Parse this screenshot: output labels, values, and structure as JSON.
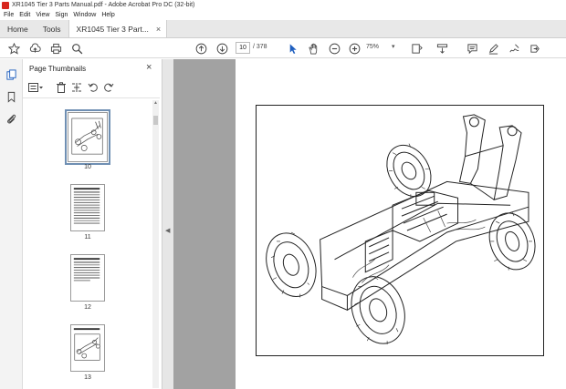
{
  "window": {
    "title": "XR1045 Tier 3 Parts Manual.pdf - Adobe Acrobat Pro DC (32-bit)"
  },
  "menu": [
    "File",
    "Edit",
    "View",
    "Sign",
    "Window",
    "Help"
  ],
  "tabs": {
    "home": "Home",
    "tools": "Tools",
    "document": "XR1045 Tier 3 Part...",
    "close": "×"
  },
  "toolbar": {
    "page_current": "10",
    "page_total": "/ 378",
    "zoom": "75%",
    "zoom_caret": "▾"
  },
  "panel": {
    "title": "Page Thumbnails",
    "close": "×",
    "thumbnails": [
      {
        "label": "10",
        "selected": true
      },
      {
        "label": "11"
      },
      {
        "label": "12"
      },
      {
        "label": "13"
      }
    ]
  },
  "colors": {
    "accent_red": "#d7261e",
    "viewer_bg": "#a2a2a2",
    "selection": "#6f8fb3"
  }
}
